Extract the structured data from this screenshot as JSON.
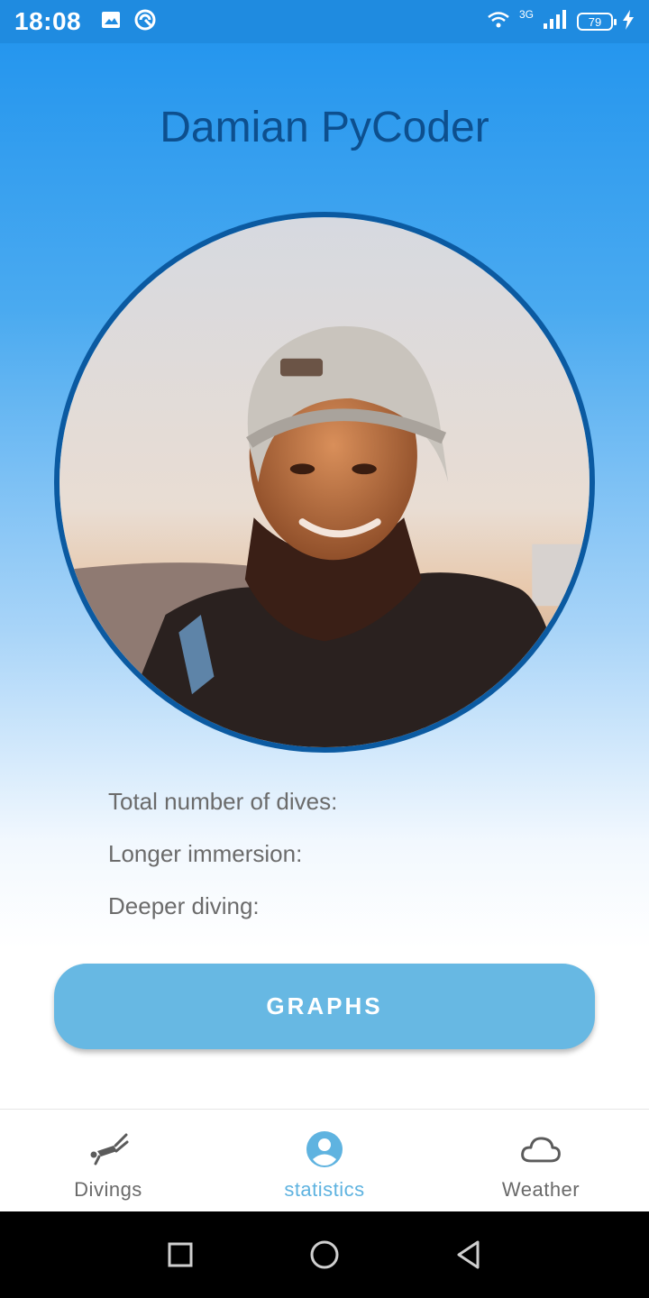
{
  "status_bar": {
    "time": "18:08",
    "network_label": "3G",
    "battery_level": "79",
    "icons": [
      "image-icon",
      "sync-icon",
      "wifi-icon",
      "signal-icon",
      "battery-icon",
      "charging-icon"
    ]
  },
  "profile": {
    "name": "Damian PyCoder",
    "avatar": "avatar-photo"
  },
  "stats": {
    "total_dives_label": "Total number of dives:",
    "longer_immersion_label": "Longer immersion:",
    "deeper_diving_label": "Deeper diving:"
  },
  "actions": {
    "graphs_label": "GRAPHS"
  },
  "bottom_nav": {
    "items": [
      {
        "label": "Divings",
        "icon": "diver-icon",
        "active": false
      },
      {
        "label": "statistics",
        "icon": "account-icon",
        "active": true
      },
      {
        "label": "Weather",
        "icon": "cloud-icon",
        "active": false
      }
    ]
  },
  "colors": {
    "header_gradient_top": "#2596ee",
    "title_color": "#0d4f8e",
    "avatar_border": "#0b5aa1",
    "button_bg": "#67b8e3",
    "nav_active": "#5fb3e0",
    "nav_inactive": "#6a6a6a"
  },
  "system_nav": {
    "icons": [
      "recents-icon",
      "home-icon",
      "back-icon"
    ]
  }
}
